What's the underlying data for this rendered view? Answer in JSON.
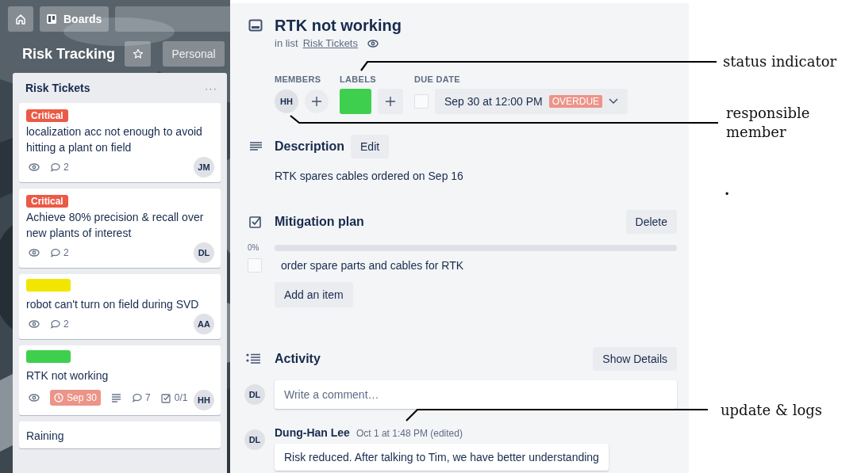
{
  "nav": {
    "boards_button": "Boards"
  },
  "board": {
    "title": "Risk Tracking",
    "starred": false,
    "workspace_button": "Personal"
  },
  "list": {
    "title": "Risk Tickets",
    "menu": "···",
    "cards": [
      {
        "label": {
          "text": "Critical",
          "color": "#eb5a46"
        },
        "title": "localization acc not enough to avoid hitting a plant on field",
        "badges": [
          {
            "kind": "watch"
          },
          {
            "kind": "comments",
            "text": "2"
          }
        ],
        "member": "JM"
      },
      {
        "label": {
          "text": "Critical",
          "color": "#eb5a46"
        },
        "title": "Achieve 80% precision & recall over new plants of interest",
        "badges": [
          {
            "kind": "watch"
          },
          {
            "kind": "comments",
            "text": "2"
          }
        ],
        "member": "DL"
      },
      {
        "label": {
          "color": "#f2e600"
        },
        "title": "robot can't turn on field during SVD",
        "badges": [
          {
            "kind": "watch"
          },
          {
            "kind": "comments",
            "text": "2"
          }
        ],
        "member": "AA"
      },
      {
        "label": {
          "color": "#3fcf4f"
        },
        "title": "RTK not working",
        "badges": [
          {
            "kind": "watch"
          },
          {
            "kind": "due",
            "text": "Sep 30",
            "overdue": true
          },
          {
            "kind": "description"
          },
          {
            "kind": "comments",
            "text": "7"
          },
          {
            "kind": "checklist",
            "text": "0/1"
          }
        ],
        "member": "HH"
      },
      {
        "title": "Raining"
      }
    ]
  },
  "card_detail": {
    "title": "RTK not working",
    "list_prefix": "in list",
    "list_link": "Risk Tickets",
    "members_heading": "MEMBERS",
    "members": [
      "HH"
    ],
    "labels_heading": "LABELS",
    "labels": [
      {
        "color": "#3fcf4f"
      }
    ],
    "due_heading": "DUE DATE",
    "due": {
      "checked": false,
      "text": "Sep 30 at 12:00 PM",
      "status": "OVERDUE"
    },
    "description": {
      "heading": "Description",
      "edit_button": "Edit",
      "text": "RTK spares cables ordered on Sep 16"
    },
    "checklist": {
      "heading": "Mitigation plan",
      "delete_button": "Delete",
      "percent": "0%",
      "level": 0,
      "items": [
        {
          "text": "order spare parts and cables for RTK",
          "checked": false
        }
      ],
      "add_button": "Add an item"
    },
    "activity": {
      "heading": "Activity",
      "details_button": "Show Details",
      "comment_avatar": "DL",
      "comment_placeholder": "Write a comment…",
      "entries": [
        {
          "avatar": "DL",
          "author": "Dung-Han Lee",
          "time": "Oct 1 at 1:48 PM (edited)",
          "text": "Risk reduced. After talking to Tim, we have better understanding"
        }
      ]
    }
  },
  "annotations": [
    {
      "kind": "label",
      "text": "status indicator"
    },
    {
      "kind": "label",
      "text": "responsible member"
    },
    {
      "kind": "mark",
      "text": "."
    },
    {
      "kind": "label",
      "text": "update & logs"
    }
  ]
}
